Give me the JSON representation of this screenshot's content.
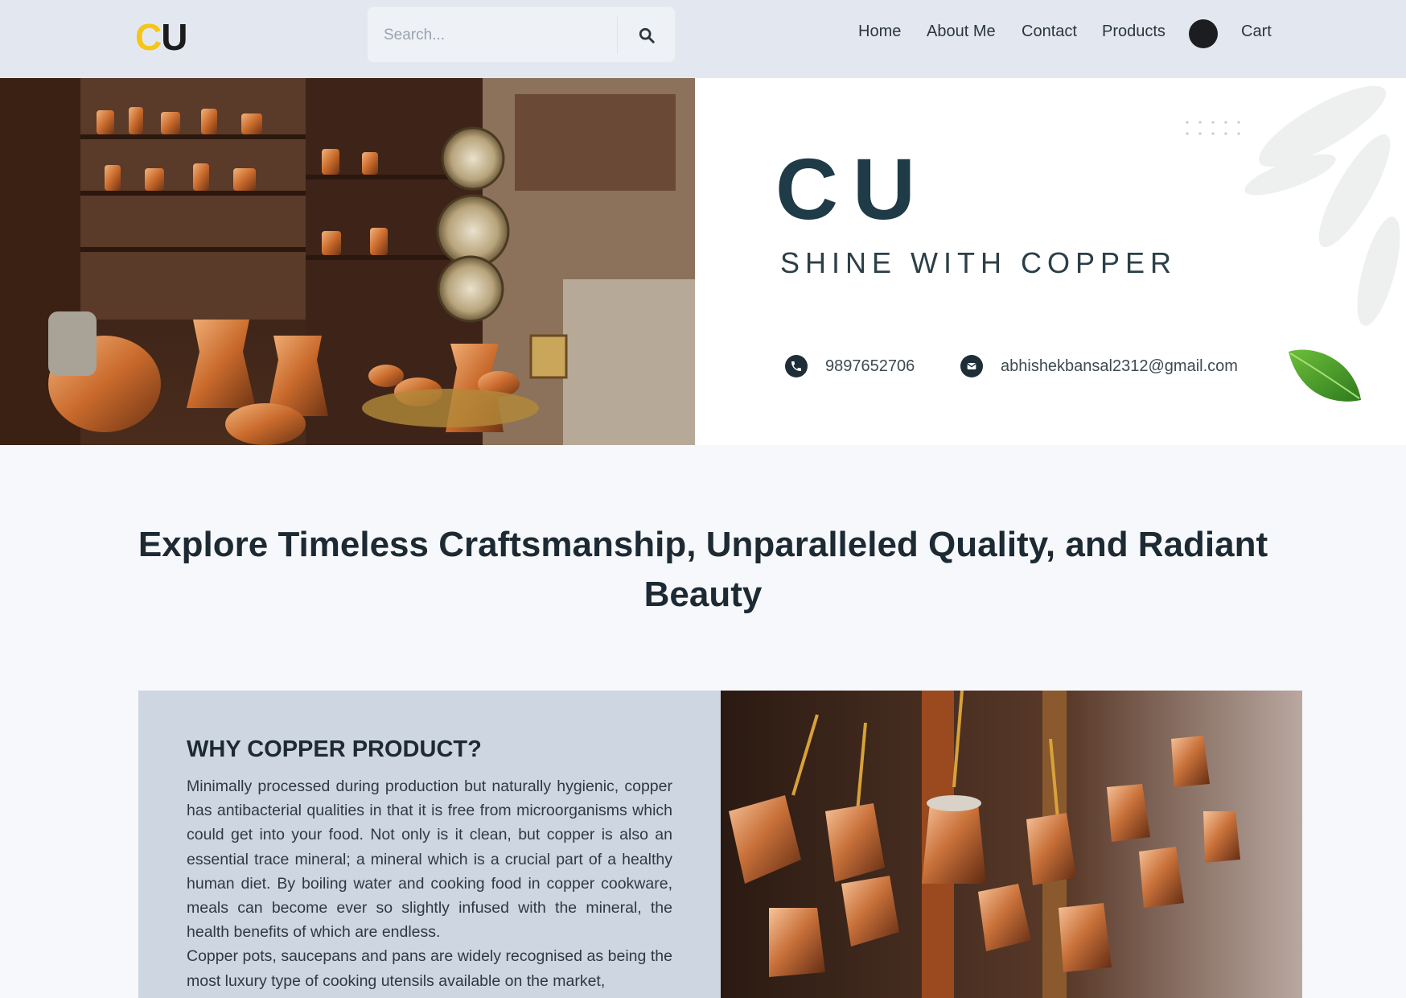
{
  "navbar": {
    "logo_c": "C",
    "logo_u": "U",
    "search_placeholder": "Search...",
    "links": {
      "home": "Home",
      "about": "About Me",
      "contact": "Contact",
      "products": "Products",
      "cart": "Cart"
    }
  },
  "hero": {
    "title": "CU",
    "subtitle": "SHINE WITH COPPER",
    "phone": "9897652706",
    "email": "abhishekbansal2312@gmail.com"
  },
  "main": {
    "heading": "Explore Timeless Craftsmanship, Unparalleled Quality, and Radiant Beauty"
  },
  "why": {
    "title": "WHY COPPER PRODUCT?",
    "paragraph1": "Minimally processed during production but naturally hygienic, copper has antibacterial qualities in that it is free from microorganisms which could get into your food. Not only is it clean, but copper is also an essential trace mineral; a mineral which is a crucial part of a healthy human diet. By boiling water and cooking food in copper cookware, meals can become ever so slightly infused with the mineral, the health benefits of which are endless.",
    "paragraph2": "Copper pots, saucepans and pans are widely recognised as being the most luxury type of cooking utensils available on the market,"
  },
  "colors": {
    "navbar_bg": "#e3e8f0",
    "logo_accent": "#f5c518",
    "hero_title": "#1e3b47",
    "card_bg": "#cdd6e1"
  }
}
